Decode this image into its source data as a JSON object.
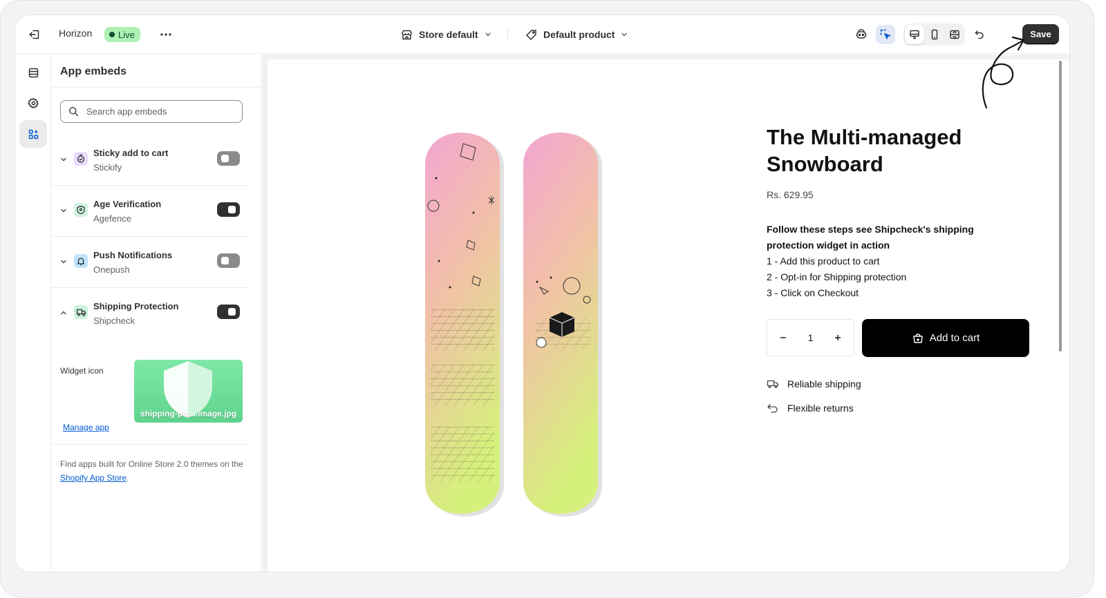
{
  "topbar": {
    "theme_name": "Horizon",
    "live_label": "Live",
    "more_label": "•••",
    "store_selector": "Store default",
    "product_selector": "Default product",
    "save_label": "Save"
  },
  "sidebar": {
    "title": "App embeds",
    "search_placeholder": "Search app embeds",
    "embeds": [
      {
        "name": "Sticky add to cart",
        "app": "Stickify",
        "enabled": false,
        "expanded": false,
        "icon_color": "#e9dcff"
      },
      {
        "name": "Age Verification",
        "app": "Agefence",
        "enabled": true,
        "expanded": false,
        "icon_color": "#cff3e1"
      },
      {
        "name": "Push Notifications",
        "app": "Onepush",
        "enabled": false,
        "expanded": false,
        "icon_color": "#d6ecff"
      },
      {
        "name": "Shipping Protection",
        "app": "Shipcheck",
        "enabled": true,
        "expanded": true,
        "icon_color": "#c9f2d9"
      }
    ],
    "widget_icon_label": "Widget icon",
    "widget_file_name": "shipping-pro...image.jpg",
    "manage_app_link": "Manage app",
    "find_apps_text": "Find apps built for Online Store 2.0 themes on the ",
    "find_apps_link": "Shopify App Store",
    "find_apps_suffix": "."
  },
  "product": {
    "title": "The Multi-managed Snowboard",
    "price": "Rs. 629.95",
    "description_heading": "Follow these steps see Shipcheck's shipping protection widget in action",
    "steps": [
      "1 - Add this product to cart",
      "2 - Opt-in for Shipping protection",
      "3 - Click on Checkout"
    ],
    "quantity": "1",
    "add_to_cart_label": "Add to cart",
    "features": [
      "Reliable shipping",
      "Flexible returns"
    ]
  },
  "colors": {
    "accent": "#303030",
    "live_badge": "#aff0b5",
    "link": "#005bd3",
    "widget_bg": "#6ddc98"
  }
}
